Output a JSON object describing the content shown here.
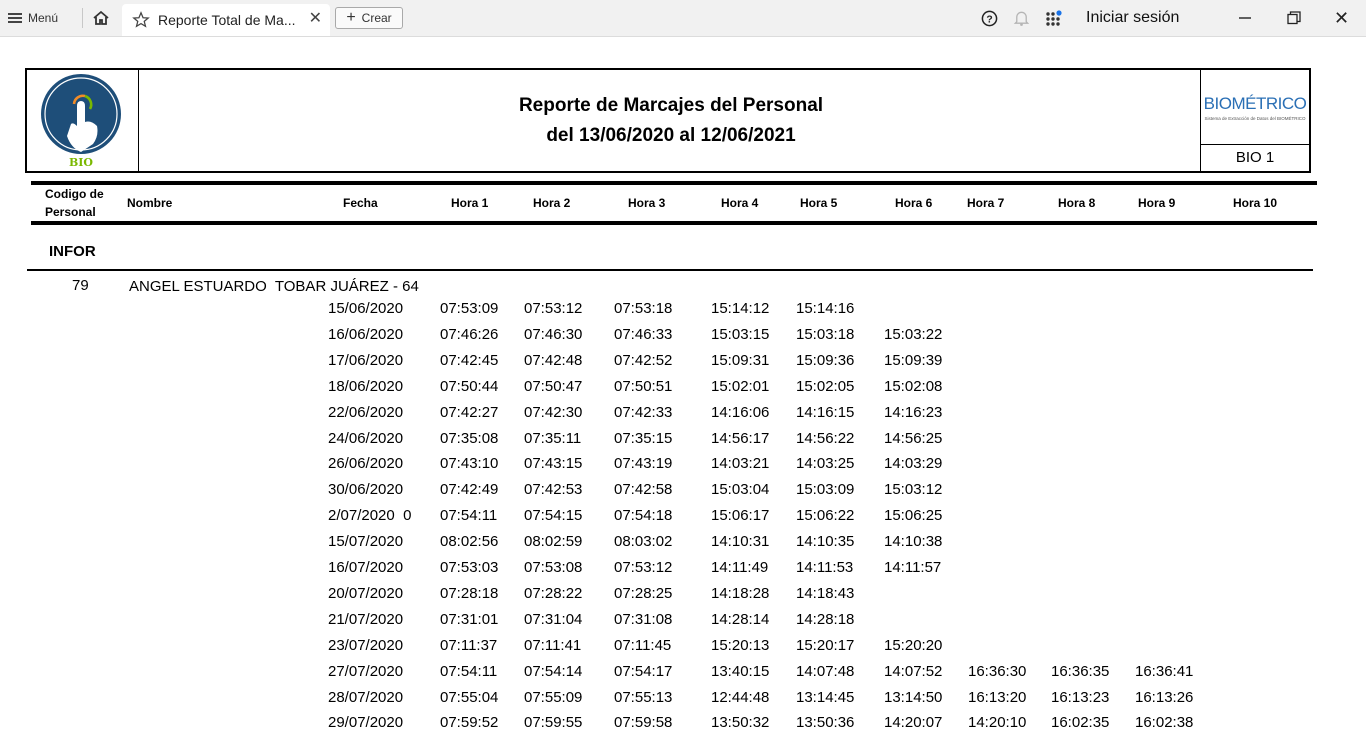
{
  "browser": {
    "menu_label": "Menú",
    "tab_title": "Reporte Total de Ma...",
    "new_label": "Crear",
    "signin_label": "Iniciar sesión"
  },
  "report": {
    "title_line1": "Reporte de Marcajes del Personal",
    "title_line2": "del 13/06/2020 al 12/06/2021",
    "logo_text": "BIO",
    "brand": "BIOMÉTRICO",
    "brand_sub": "Sistema de Extracción de Datos del BIOMÉTRICO",
    "device": "BIO 1"
  },
  "columns": {
    "code_line1": "Codigo de",
    "code_line2": "Personal",
    "name": "Nombre",
    "date": "Fecha",
    "hours": [
      "Hora 1",
      "Hora 2",
      "Hora 3",
      "Hora 4",
      "Hora 5",
      "Hora 6",
      "Hora 7",
      "Hora 8",
      "Hora 9",
      "Hora 10"
    ]
  },
  "section": "INFOR",
  "employee": {
    "code": "79",
    "name": "ANGEL ESTUARDO  TOBAR JUÁREZ - 64"
  },
  "records": [
    {
      "date": "15/06/2020",
      "times": [
        "07:53:09",
        "07:53:12",
        "07:53:18",
        "15:14:12",
        "15:14:16",
        "",
        "",
        "",
        ""
      ]
    },
    {
      "date": "16/06/2020",
      "times": [
        "07:46:26",
        "07:46:30",
        "07:46:33",
        "15:03:15",
        "15:03:18",
        "15:03:22",
        "",
        "",
        ""
      ]
    },
    {
      "date": "17/06/2020",
      "times": [
        "07:42:45",
        "07:42:48",
        "07:42:52",
        "15:09:31",
        "15:09:36",
        "15:09:39",
        "",
        "",
        ""
      ]
    },
    {
      "date": "18/06/2020",
      "times": [
        "07:50:44",
        "07:50:47",
        "07:50:51",
        "15:02:01",
        "15:02:05",
        "15:02:08",
        "",
        "",
        ""
      ]
    },
    {
      "date": "22/06/2020",
      "times": [
        "07:42:27",
        "07:42:30",
        "07:42:33",
        "14:16:06",
        "14:16:15",
        "14:16:23",
        "",
        "",
        ""
      ]
    },
    {
      "date": "24/06/2020",
      "times": [
        "07:35:08",
        "07:35:11",
        "07:35:15",
        "14:56:17",
        "14:56:22",
        "14:56:25",
        "",
        "",
        ""
      ]
    },
    {
      "date": "26/06/2020",
      "times": [
        "07:43:10",
        "07:43:15",
        "07:43:19",
        "14:03:21",
        "14:03:25",
        "14:03:29",
        "",
        "",
        ""
      ]
    },
    {
      "date": "30/06/2020",
      "times": [
        "07:42:49",
        "07:42:53",
        "07:42:58",
        "15:03:04",
        "15:03:09",
        "15:03:12",
        "",
        "",
        ""
      ]
    },
    {
      "date": "2/07/2020  0",
      "times": [
        "07:54:11",
        "07:54:15",
        "07:54:18",
        "15:06:17",
        "15:06:22",
        "15:06:25",
        "",
        "",
        ""
      ]
    },
    {
      "date": "15/07/2020",
      "times": [
        "08:02:56",
        "08:02:59",
        "08:03:02",
        "14:10:31",
        "14:10:35",
        "14:10:38",
        "",
        "",
        ""
      ]
    },
    {
      "date": "16/07/2020",
      "times": [
        "07:53:03",
        "07:53:08",
        "07:53:12",
        "14:11:49",
        "14:11:53",
        "14:11:57",
        "",
        "",
        ""
      ]
    },
    {
      "date": "20/07/2020",
      "times": [
        "07:28:18",
        "07:28:22",
        "07:28:25",
        "14:18:28",
        "14:18:43",
        "",
        "",
        "",
        ""
      ]
    },
    {
      "date": "21/07/2020",
      "times": [
        "07:31:01",
        "07:31:04",
        "07:31:08",
        "14:28:14",
        "14:28:18",
        "",
        "",
        "",
        ""
      ]
    },
    {
      "date": "23/07/2020",
      "times": [
        "07:11:37",
        "07:11:41",
        "07:11:45",
        "15:20:13",
        "15:20:17",
        "15:20:20",
        "",
        "",
        ""
      ]
    },
    {
      "date": "27/07/2020",
      "times": [
        "07:54:11",
        "07:54:14",
        "07:54:17",
        "13:40:15",
        "14:07:48",
        "14:07:52",
        "16:36:30",
        "16:36:35",
        "16:36:41"
      ]
    },
    {
      "date": "28/07/2020",
      "times": [
        "07:55:04",
        "07:55:09",
        "07:55:13",
        "12:44:48",
        "13:14:45",
        "13:14:50",
        "16:13:20",
        "16:13:23",
        "16:13:26"
      ]
    },
    {
      "date": "29/07/2020",
      "times": [
        "07:59:52",
        "07:59:55",
        "07:59:58",
        "13:50:32",
        "13:50:36",
        "14:20:07",
        "14:20:10",
        "16:02:35",
        "16:02:38"
      ]
    }
  ],
  "colors": {
    "logo_blue": "#1e4e79",
    "brand_blue": "#2a6fb5",
    "accent_green": "#7ab800",
    "accent_orange": "#f28c28"
  }
}
